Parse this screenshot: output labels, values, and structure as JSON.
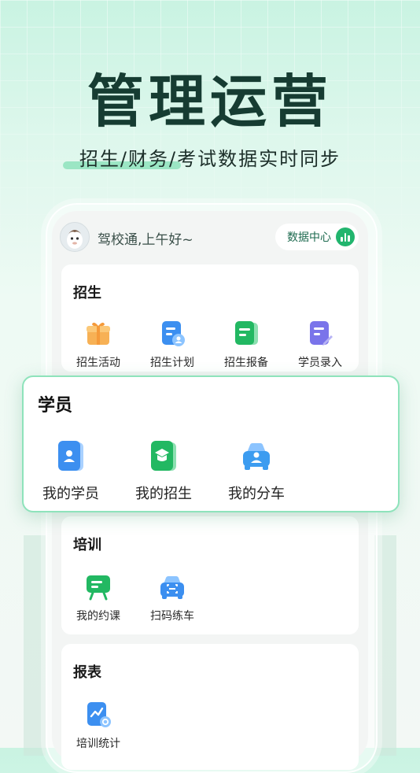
{
  "hero": {
    "title": "管理运营",
    "subtitle": "招生/财务/考试数据实时同步"
  },
  "header": {
    "greeting": "驾校通,上午好~",
    "data_center_label": "数据中心",
    "data_center_icon": "bar-chart-icon"
  },
  "sections": {
    "enroll": {
      "title": "招生",
      "items": [
        {
          "label": "招生活动",
          "icon": "gift-icon",
          "color": "#f5a54a"
        },
        {
          "label": "招生计划",
          "icon": "plan-document-icon",
          "color": "#3c8ff0"
        },
        {
          "label": "招生报备",
          "icon": "report-note-icon",
          "color": "#22b862"
        },
        {
          "label": "学员录入",
          "icon": "edit-note-icon",
          "color": "#7a74ea"
        }
      ]
    },
    "students": {
      "title": "学员",
      "items": [
        {
          "label": "我的学员",
          "icon": "student-card-icon",
          "color": "#3c8ff0"
        },
        {
          "label": "我的招生",
          "icon": "graduation-book-icon",
          "color": "#22b862"
        },
        {
          "label": "我的分车",
          "icon": "car-person-icon",
          "color": "#3c9cf0"
        }
      ]
    },
    "training": {
      "title": "培训",
      "items": [
        {
          "label": "我的约课",
          "icon": "blackboard-icon",
          "color": "#22b862"
        },
        {
          "label": "扫码练车",
          "icon": "scan-car-icon",
          "color": "#3c8ff0"
        }
      ]
    },
    "reports": {
      "title": "报表",
      "items": [
        {
          "label": "培训统计",
          "icon": "stats-chart-icon",
          "color": "#3c8ff0"
        }
      ]
    }
  }
}
